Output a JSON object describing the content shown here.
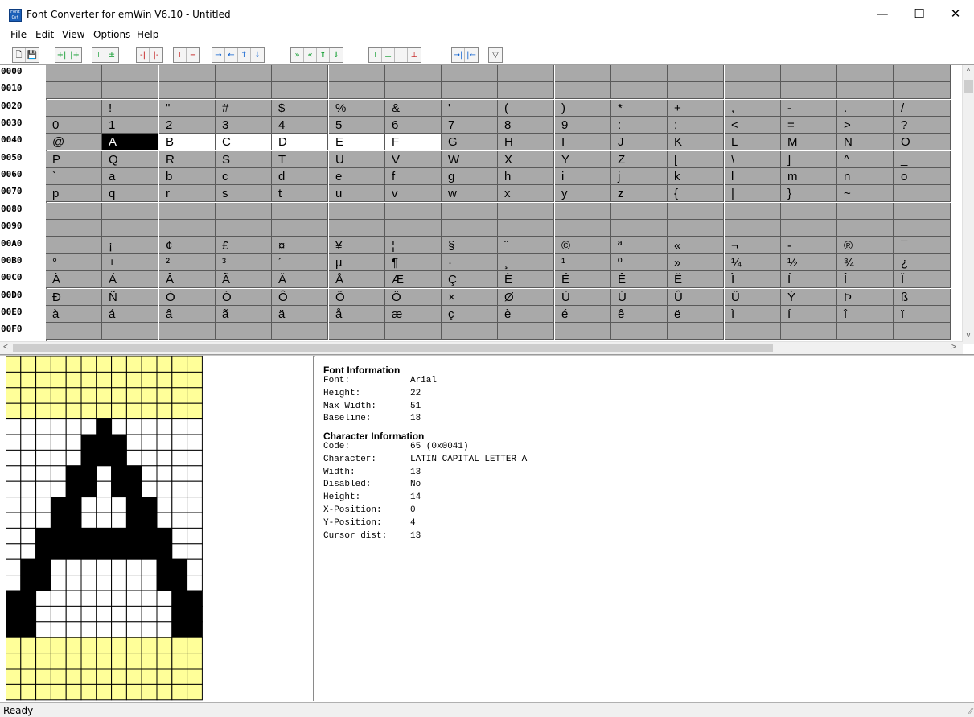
{
  "window": {
    "title": "Font Converter for emWin V6.10 - Untitled",
    "icon_text": "Font Cvt",
    "minimize": "—",
    "maximize": "☐",
    "close": "✕"
  },
  "menu": [
    {
      "pre": "",
      "ul": "F",
      "post": "ile"
    },
    {
      "pre": "",
      "ul": "E",
      "post": "dit"
    },
    {
      "pre": "",
      "ul": "V",
      "post": "iew"
    },
    {
      "pre": "",
      "ul": "O",
      "post": "ptions"
    },
    {
      "pre": "",
      "ul": "H",
      "post": "elp"
    }
  ],
  "toolbar": {
    "groups": [
      {
        "name": "file",
        "buttons": [
          {
            "icon": "new-file-icon",
            "glyph": "🗋",
            "color": "dark"
          },
          {
            "icon": "save-icon",
            "glyph": "💾",
            "color": "dark"
          }
        ]
      },
      {
        "name": "insert-col",
        "buttons": [
          {
            "icon": "insert-left-icon",
            "glyph": "+|",
            "color": "green"
          },
          {
            "icon": "insert-right-icon",
            "glyph": "|+",
            "color": "green"
          }
        ]
      },
      {
        "name": "insert-row",
        "buttons": [
          {
            "icon": "insert-top-icon",
            "glyph": "⊤",
            "color": "green"
          },
          {
            "icon": "insert-bottom-icon",
            "glyph": "±",
            "color": "green"
          }
        ]
      },
      {
        "name": "delete-col",
        "buttons": [
          {
            "icon": "delete-left-icon",
            "glyph": "-|",
            "color": "red"
          },
          {
            "icon": "delete-right-icon",
            "glyph": "|-",
            "color": "red"
          }
        ]
      },
      {
        "name": "delete-row",
        "buttons": [
          {
            "icon": "delete-top-icon",
            "glyph": "⊤",
            "color": "red"
          },
          {
            "icon": "delete-bottom-icon",
            "glyph": "−",
            "color": "red"
          }
        ]
      },
      {
        "name": "move",
        "buttons": [
          {
            "icon": "arrow-right-icon",
            "glyph": "→",
            "color": "blue"
          },
          {
            "icon": "arrow-left-icon",
            "glyph": "←",
            "color": "blue"
          },
          {
            "icon": "arrow-up-icon",
            "glyph": "↑",
            "color": "blue"
          },
          {
            "icon": "arrow-down-icon",
            "glyph": "↓",
            "color": "blue"
          }
        ]
      },
      {
        "name": "shift",
        "buttons": [
          {
            "icon": "shift-right-icon",
            "glyph": "»",
            "color": "green"
          },
          {
            "icon": "shift-left-icon",
            "glyph": "«",
            "color": "green"
          },
          {
            "icon": "shift-up-icon",
            "glyph": "⇑",
            "color": "green"
          },
          {
            "icon": "shift-down-icon",
            "glyph": "⇓",
            "color": "green"
          }
        ]
      },
      {
        "name": "pad",
        "buttons": [
          {
            "icon": "pad-top-green-icon",
            "glyph": "⊤",
            "color": "green"
          },
          {
            "icon": "pad-bottom-green-icon",
            "glyph": "⊥",
            "color": "green"
          },
          {
            "icon": "pad-top-red-icon",
            "glyph": "⊤",
            "color": "red"
          },
          {
            "icon": "pad-bottom-red-icon",
            "glyph": "⊥",
            "color": "red"
          }
        ]
      },
      {
        "name": "align",
        "buttons": [
          {
            "icon": "align-right-icon",
            "glyph": "→|",
            "color": "blue"
          },
          {
            "icon": "align-left-icon",
            "glyph": "|←",
            "color": "blue"
          }
        ]
      },
      {
        "name": "filter",
        "buttons": [
          {
            "icon": "filter-icon",
            "glyph": "▽",
            "color": "dark"
          }
        ]
      }
    ]
  },
  "grid": {
    "rows": [
      {
        "label": "0000",
        "cells": [
          "",
          "",
          "",
          "",
          "",
          "",
          "",
          "",
          "",
          "",
          "",
          "",
          "",
          "",
          "",
          ""
        ]
      },
      {
        "label": "0010",
        "cells": [
          "",
          "",
          "",
          "",
          "",
          "",
          "",
          "",
          "",
          "",
          "",
          "",
          "",
          "",
          "",
          ""
        ]
      },
      {
        "label": "0020",
        "cells": [
          "",
          "!",
          "\"",
          "#",
          "$",
          "%",
          "&",
          "'",
          "(",
          ")",
          "*",
          "+",
          ",",
          "-",
          ".",
          "/"
        ]
      },
      {
        "label": "0030",
        "cells": [
          "0",
          "1",
          "2",
          "3",
          "4",
          "5",
          "6",
          "7",
          "8",
          "9",
          ":",
          ";",
          "<",
          "=",
          ">",
          "?"
        ]
      },
      {
        "label": "0040",
        "cells": [
          "@",
          "A",
          "B",
          "C",
          "D",
          "E",
          "F",
          "G",
          "H",
          "I",
          "J",
          "K",
          "L",
          "M",
          "N",
          "O"
        ]
      },
      {
        "label": "0050",
        "cells": [
          "P",
          "Q",
          "R",
          "S",
          "T",
          "U",
          "V",
          "W",
          "X",
          "Y",
          "Z",
          "[",
          "\\",
          "]",
          "^",
          "_"
        ]
      },
      {
        "label": "0060",
        "cells": [
          "`",
          "a",
          "b",
          "c",
          "d",
          "e",
          "f",
          "g",
          "h",
          "i",
          "j",
          "k",
          "l",
          "m",
          "n",
          "o"
        ]
      },
      {
        "label": "0070",
        "cells": [
          "p",
          "q",
          "r",
          "s",
          "t",
          "u",
          "v",
          "w",
          "x",
          "y",
          "z",
          "{",
          "|",
          "}",
          "~",
          ""
        ]
      },
      {
        "label": "0080",
        "cells": [
          "",
          "",
          "",
          "",
          "",
          "",
          "",
          "",
          "",
          "",
          "",
          "",
          "",
          "",
          "",
          ""
        ]
      },
      {
        "label": "0090",
        "cells": [
          "",
          "",
          "",
          "",
          "",
          "",
          "",
          "",
          "",
          "",
          "",
          "",
          "",
          "",
          "",
          ""
        ]
      },
      {
        "label": "00A0",
        "cells": [
          "",
          "¡",
          "¢",
          "£",
          "¤",
          "¥",
          "¦",
          "§",
          "¨",
          "©",
          "ª",
          "«",
          "¬",
          "-",
          "®",
          "¯"
        ]
      },
      {
        "label": "00B0",
        "cells": [
          "°",
          "±",
          "²",
          "³",
          "´",
          "µ",
          "¶",
          "·",
          "¸",
          "¹",
          "º",
          "»",
          "¼",
          "½",
          "¾",
          "¿"
        ]
      },
      {
        "label": "00C0",
        "cells": [
          "À",
          "Á",
          "Â",
          "Ã",
          "Ä",
          "Å",
          "Æ",
          "Ç",
          "È",
          "É",
          "Ê",
          "Ë",
          "Ì",
          "Í",
          "Î",
          "Ï"
        ]
      },
      {
        "label": "00D0",
        "cells": [
          "Ð",
          "Ñ",
          "Ò",
          "Ó",
          "Ô",
          "Õ",
          "Ö",
          "×",
          "Ø",
          "Ù",
          "Ú",
          "Û",
          "Ü",
          "Ý",
          "Þ",
          "ß"
        ]
      },
      {
        "label": "00E0",
        "cells": [
          "à",
          "á",
          "â",
          "ã",
          "ä",
          "å",
          "æ",
          "ç",
          "è",
          "é",
          "ê",
          "ë",
          "ì",
          "í",
          "î",
          "ï"
        ]
      },
      {
        "label": "00F0",
        "cells": [
          "",
          "",
          "",
          "",
          "",
          "",
          "",
          "",
          "",
          "",
          "",
          "",
          "",
          "",
          "",
          ""
        ]
      }
    ],
    "selected": {
      "row": 4,
      "col": 1
    },
    "highlighted": [
      {
        "row": 4,
        "col": 2
      },
      {
        "row": 4,
        "col": 3
      },
      {
        "row": 4,
        "col": 4
      },
      {
        "row": 4,
        "col": 5
      },
      {
        "row": 4,
        "col": 6
      }
    ]
  },
  "glyph": {
    "columns": 13,
    "bitmap": [
      "0000000000000",
      "0000000000000",
      "0000000000000",
      "0000000000000",
      "0000001000000",
      "0000011100000",
      "0000011100000",
      "0000110110000",
      "0000110110000",
      "0001100011000",
      "0001100011000",
      "0011111111100",
      "0011111111100",
      "0110000000110",
      "0110000000110",
      "1100000000011",
      "1100000000011",
      "1100000000011",
      "0000000000000",
      "0000000000000",
      "0000000000000",
      "0000000000000"
    ],
    "padding_rows_top": 4,
    "padding_rows_bottom": 4
  },
  "font_info": {
    "title": "Font Information",
    "rows": [
      {
        "k": "Font:",
        "v": "Arial"
      },
      {
        "k": "Height:",
        "v": "22"
      },
      {
        "k": "Max Width:",
        "v": "51"
      },
      {
        "k": "Baseline:",
        "v": "18"
      }
    ]
  },
  "char_info": {
    "title": "Character Information",
    "rows": [
      {
        "k": "Code:",
        "v": "65 (0x0041)"
      },
      {
        "k": "Character:",
        "v": "LATIN CAPITAL LETTER A"
      },
      {
        "k": "Width:",
        "v": "13"
      },
      {
        "k": "Disabled:",
        "v": "No"
      },
      {
        "k": "Height:",
        "v": "14"
      },
      {
        "k": "X-Position:",
        "v": "0"
      },
      {
        "k": "Y-Position:",
        "v": "4"
      },
      {
        "k": "Cursor dist:",
        "v": "13"
      }
    ]
  },
  "status": {
    "text": "Ready"
  },
  "colors": {
    "pad": "#ffff99",
    "cell_bg": "#a9a9a9",
    "selected": "#000000"
  }
}
